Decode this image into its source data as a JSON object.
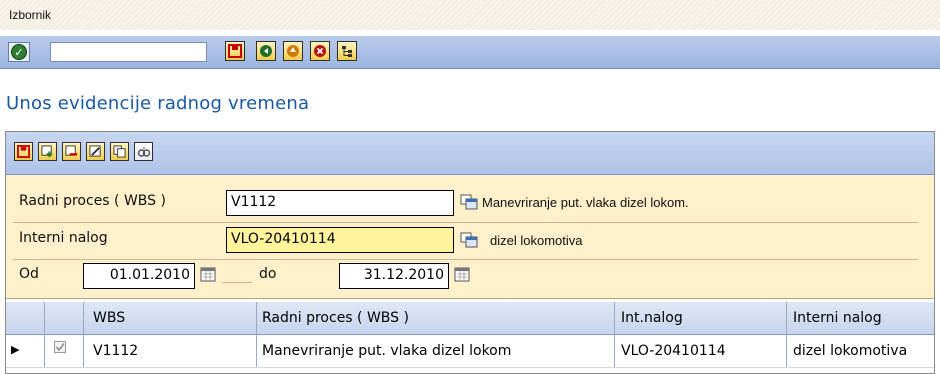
{
  "menu": {
    "label": "Izbornik"
  },
  "toolbar": {
    "command_value": "",
    "buttons": [
      "save-icon",
      "back-icon",
      "exit-icon",
      "cancel-icon",
      "tree-icon"
    ]
  },
  "page": {
    "title": "Unos evidencije radnog vremena"
  },
  "panel_toolbar": {
    "buttons": [
      "save-icon",
      "add-row-icon",
      "delete-row-icon",
      "edit-icon",
      "copy-icon",
      "find-icon"
    ]
  },
  "form": {
    "wbs_label": "Radni proces ( WBS )",
    "wbs_value": "V1112",
    "wbs_desc": "Manevriranje put. vlaka dizel lokom.",
    "order_label": "Interni nalog",
    "order_value": "VLO-20410114",
    "order_desc": "dizel lokomotiva",
    "from_label": "Od",
    "from_value": "01.01.2010",
    "to_label": "do",
    "to_value": "31.12.2010"
  },
  "table": {
    "columns": [
      "WBS",
      "Radni proces ( WBS )",
      "Int.nalog",
      "Interni nalog"
    ],
    "rows": [
      {
        "wbs": "V1112",
        "process": "Manevriranje put. vlaka dizel lokom",
        "order": "VLO-20410114",
        "order_name": "dizel lokomotiva",
        "checked": true
      }
    ]
  },
  "colors": {
    "title": "#1b59a0",
    "form_bg": "#fdf0cb",
    "toolbar": "#aec3e8"
  }
}
